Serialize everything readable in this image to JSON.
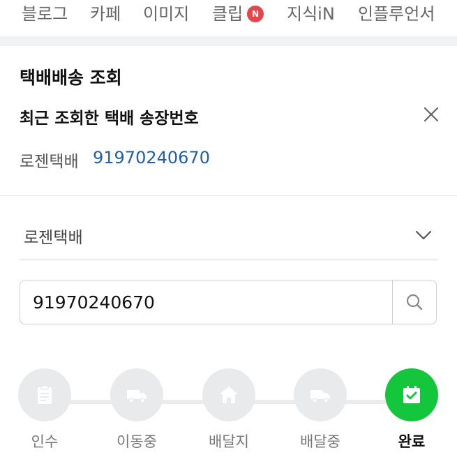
{
  "nav": {
    "tabs": [
      {
        "label": "블로그"
      },
      {
        "label": "카페"
      },
      {
        "label": "이미지"
      },
      {
        "label": "클립",
        "badge": "N"
      },
      {
        "label": "지식iN"
      },
      {
        "label": "인플루언서"
      }
    ]
  },
  "tracker": {
    "title": "택배배송 조회",
    "recent_heading": "최근 조회한 택배 송장번호",
    "recent": {
      "carrier": "로젠택배",
      "number": "91970240670"
    },
    "carrier_select": {
      "value": "로젠택배"
    },
    "search": {
      "value": "91970240670"
    },
    "steps": [
      {
        "label": "인수",
        "icon": "clipboard-icon",
        "state": "inactive"
      },
      {
        "label": "이동중",
        "icon": "truck-icon",
        "state": "inactive"
      },
      {
        "label": "배달지",
        "icon": "house-icon",
        "state": "inactive"
      },
      {
        "label": "배달중",
        "icon": "truck-icon",
        "state": "inactive"
      },
      {
        "label": "완료",
        "icon": "calendar-check-icon",
        "state": "active"
      }
    ]
  },
  "colors": {
    "link": "#1f5fa8",
    "active_step": "#13c63c",
    "inactive_step": "#e9eaec",
    "badge": "#e8454a"
  }
}
